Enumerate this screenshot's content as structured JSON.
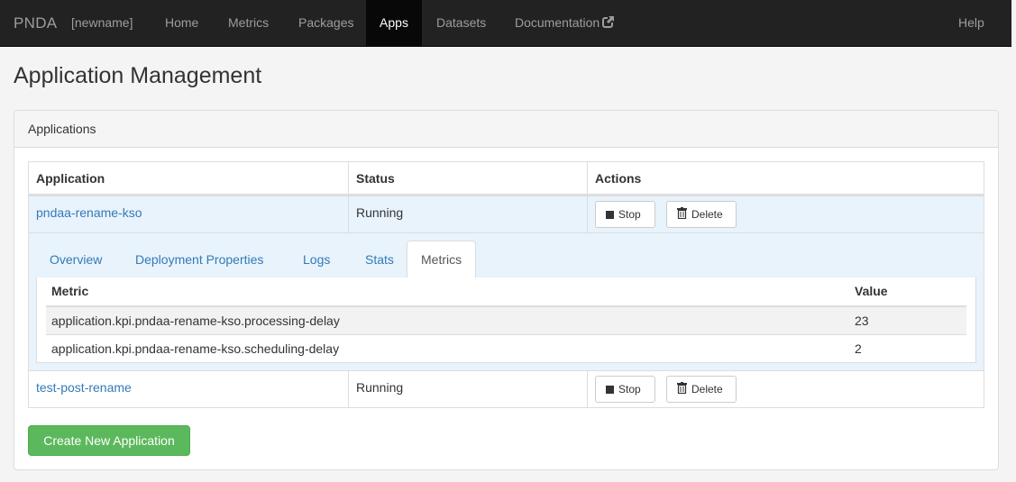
{
  "navbar": {
    "brand": "PNDA",
    "environment": "[newname]",
    "items": [
      {
        "label": "Home",
        "active": false
      },
      {
        "label": "Metrics",
        "active": false
      },
      {
        "label": "Packages",
        "active": false
      },
      {
        "label": "Apps",
        "active": true
      },
      {
        "label": "Datasets",
        "active": false
      },
      {
        "label": "Documentation",
        "active": false,
        "icon": "external-link-icon"
      }
    ],
    "help": "Help"
  },
  "page": {
    "title": "Application Management"
  },
  "panel": {
    "heading": "Applications",
    "columns": [
      "Application",
      "Status",
      "Actions"
    ],
    "applications": [
      {
        "name": "pndaa-rename-kso",
        "status": "Running",
        "stop_label": "Stop",
        "delete_label": "Delete",
        "expanded": true
      },
      {
        "name": "test-post-rename",
        "status": "Running",
        "stop_label": "Stop",
        "delete_label": "Delete",
        "expanded": false
      }
    ],
    "detail": {
      "tabs": [
        {
          "label": "Overview",
          "active": false
        },
        {
          "label": "Deployment Properties",
          "active": false
        },
        {
          "label": "Logs",
          "active": false
        },
        {
          "label": "Stats",
          "active": false
        },
        {
          "label": "Metrics",
          "active": true
        }
      ],
      "metrics_columns": [
        "Metric",
        "Value"
      ],
      "metrics": [
        {
          "metric": "application.kpi.pndaa-rename-kso.processing-delay",
          "value": "23"
        },
        {
          "metric": "application.kpi.pndaa-rename-kso.scheduling-delay",
          "value": "2"
        }
      ]
    },
    "create_button": "Create New Application"
  },
  "colors": {
    "navbar_bg": "#222222",
    "link": "#337ab7",
    "success": "#5cb85c",
    "selected_row": "#e8f3fc"
  }
}
